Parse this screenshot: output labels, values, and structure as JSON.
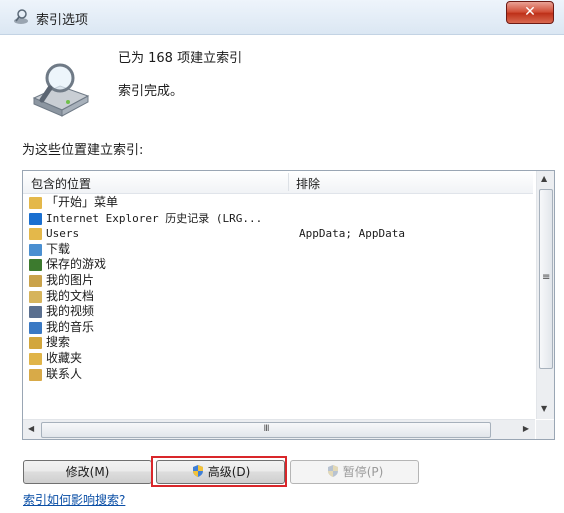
{
  "window": {
    "title": "索引选项",
    "close_symbol": "✕"
  },
  "status": {
    "count_text": "已为 168 项建立索引",
    "state_text": "索引完成。"
  },
  "locations": {
    "section_label": "为这些位置建立索引:",
    "headers": {
      "included": "包含的位置",
      "excluded": "排除"
    },
    "items": [
      {
        "name": "「开始」菜单",
        "exclude": "",
        "icon": "folder-icon",
        "color": "#e4b84a"
      },
      {
        "name": "Internet Explorer 历史记录 (LRG...",
        "exclude": "",
        "icon": "ie-icon",
        "color": "#1a6fd0"
      },
      {
        "name": "Users",
        "exclude": "AppData; AppData",
        "icon": "folder-icon",
        "color": "#e4b84a"
      },
      {
        "name": "下载",
        "exclude": "",
        "icon": "downloads-folder-icon",
        "color": "#4a8fd1"
      },
      {
        "name": "保存的游戏",
        "exclude": "",
        "icon": "saved-games-icon",
        "color": "#3c7a2e"
      },
      {
        "name": "我的图片",
        "exclude": "",
        "icon": "pictures-folder-icon",
        "color": "#c9a24a"
      },
      {
        "name": "我的文档",
        "exclude": "",
        "icon": "documents-folder-icon",
        "color": "#d6b45c"
      },
      {
        "name": "我的视频",
        "exclude": "",
        "icon": "videos-folder-icon",
        "color": "#5a6f8f"
      },
      {
        "name": "我的音乐",
        "exclude": "",
        "icon": "music-folder-icon",
        "color": "#3a79c4"
      },
      {
        "name": "搜索",
        "exclude": "",
        "icon": "searches-folder-icon",
        "color": "#d2a63c"
      },
      {
        "name": "收藏夹",
        "exclude": "",
        "icon": "favorites-folder-icon",
        "color": "#e0b448"
      },
      {
        "name": "联系人",
        "exclude": "",
        "icon": "contacts-folder-icon",
        "color": "#d8aa48"
      }
    ],
    "scroll": {
      "up": "▲",
      "down": "▼",
      "left": "◀",
      "right": "▶",
      "grip_v": "≡",
      "grip_h": "III"
    }
  },
  "buttons": {
    "modify": "修改(M)",
    "advanced": "高级(D)",
    "pause": "暂停(P)"
  },
  "help_link": "索引如何影响搜索?",
  "colors": {
    "highlight_border": "#d9262a",
    "link": "#0b4fa6",
    "close_button": "#c8412b"
  }
}
